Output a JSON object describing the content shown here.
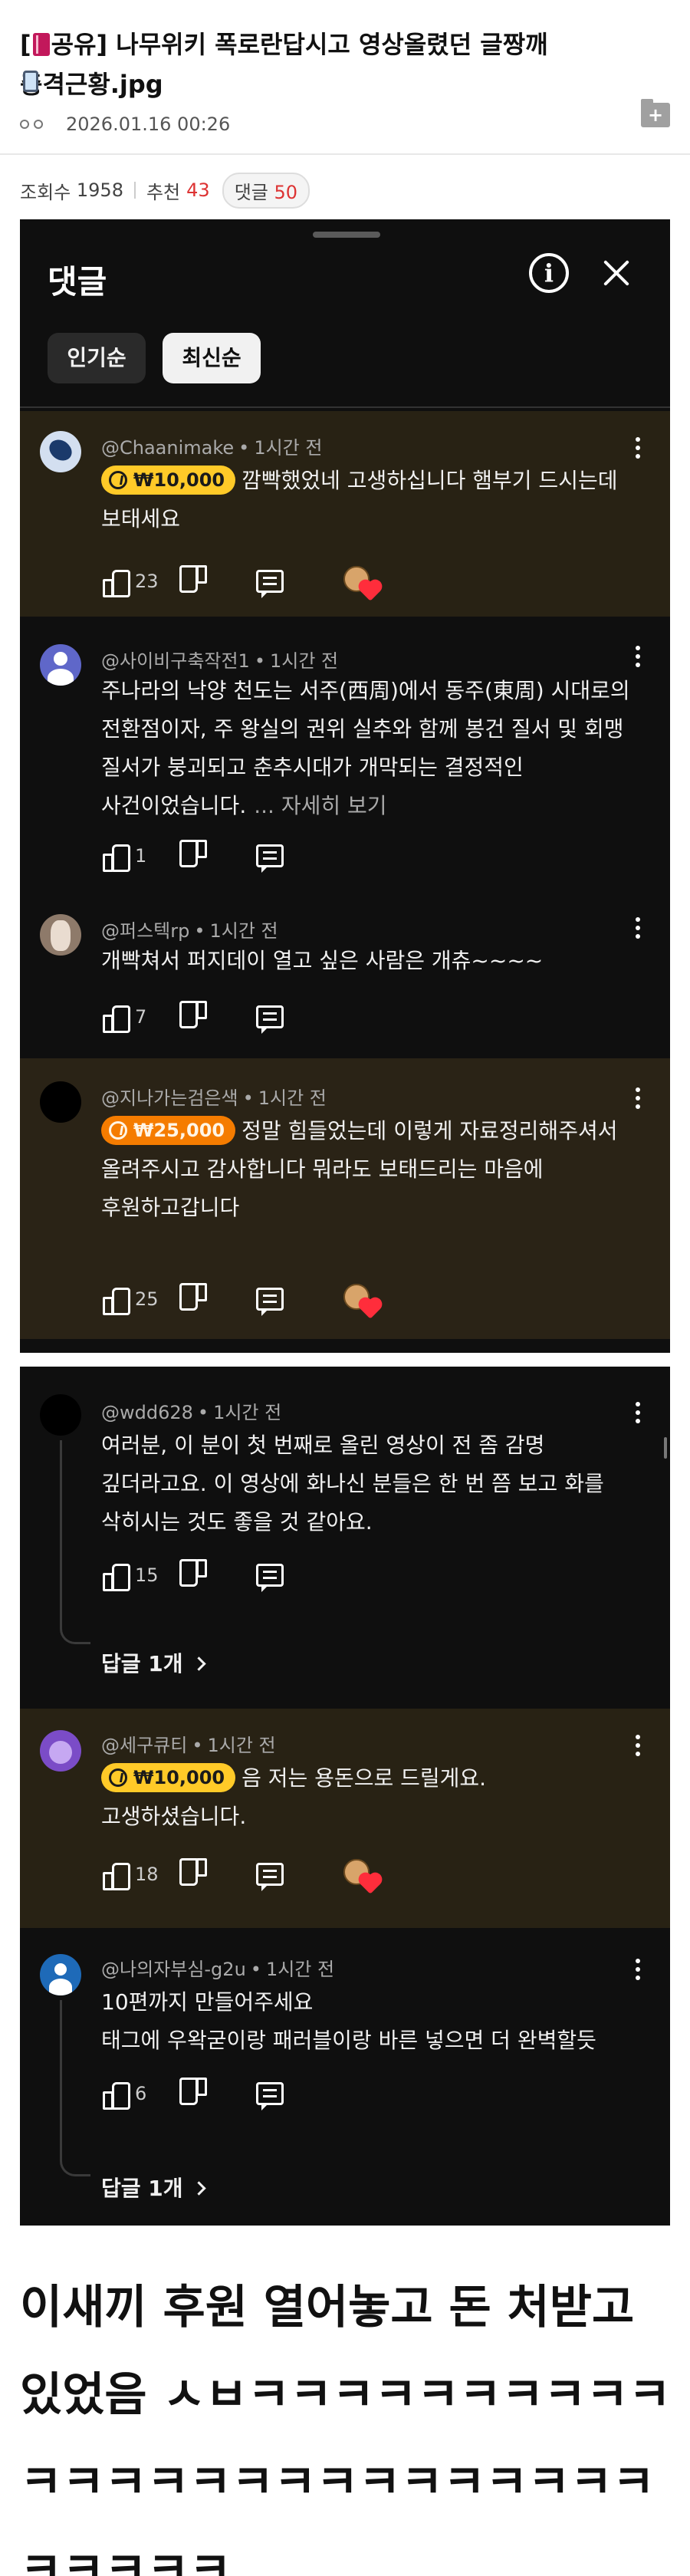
{
  "post": {
    "title_tag": "[",
    "title_category": "공유]",
    "title_text": " 나무위키 폭로란답시고 영상올렸던 글짱깨 충격근황.jpg",
    "date": "2026.01.16 00:26",
    "views_label": "조회수",
    "views": "1958",
    "recommend_label": "추천",
    "recommend": "43",
    "comments_label": "댓글",
    "comments": "50"
  },
  "panel": {
    "title": "댓글",
    "info_icon": "i",
    "chips": [
      "인기순",
      "최신순"
    ],
    "selected_chip": "최신순"
  },
  "comments": [
    {
      "handle": "@Chaanimake",
      "time": "1시간 전",
      "superchat": "₩10,000",
      "superchat_color": "#ffca28",
      "text": "깜빡했었네 고생하십니다 햄부기 드시는데 보태세요",
      "likes": "23",
      "creator_heart": true
    },
    {
      "handle": "@사이비구축작전1",
      "time": "1시간 전",
      "text": "주나라의 낙양 천도는 서주(西周)에서 동주(東周) 시대로의 전환점이자, 주 왕실의 권위 실추와 함께 봉건 질서 및 회맹 질서가 붕괴되고 춘추시대가 개막되는 결정적인 사건이었습니다.",
      "more": "... 자세히 보기",
      "likes": "1"
    },
    {
      "handle": "@퍼스텍rp",
      "time": "1시간 전",
      "text": "개빡쳐서 퍼지데이 열고 싶은 사람은 개츄~~~~",
      "likes": "7"
    },
    {
      "handle": "@지나가는검은색",
      "time": "1시간 전",
      "superchat": "₩25,000",
      "superchat_color": "#f57c00",
      "text": "정말 힘들었는데 이렇게 자료정리해주셔서 올려주시고 감사합니다 뭐라도 보태드리는 마음에 후원하고갑니다",
      "likes": "25",
      "creator_heart": true
    },
    {
      "handle": "@wdd628",
      "time": "1시간 전",
      "text": "여러분, 이 분이 첫 번째로 올린 영상이 전 좀 감명 깊더라고요. 이 영상에 화나신 분들은 한 번 쯤 보고 화를 삭히시는 것도 좋을 것 같아요.",
      "likes": "15",
      "replies": "답글 1개"
    },
    {
      "handle": "@세구큐티",
      "time": "1시간 전",
      "superchat": "₩10,000",
      "superchat_color": "#ffca28",
      "text": "음 저는 용돈으로 드릴게요. 고생하셨습니다.",
      "likes": "18",
      "creator_heart": true
    },
    {
      "handle": "@나의자부심-g2u",
      "time": "1시간 전",
      "text_line1": "10편까지 만들어주세요",
      "text_line2": "태그에 우왁굳이랑 패러블이랑 바른 넣으면 더 완벽할듯",
      "likes": "6",
      "replies": "답글 1개"
    }
  ],
  "caption": "이새끼 후원 열어놓고 돈 처받고 있었음 ㅅㅂㅋㅋㅋㅋㅋㅋㅋㅋㅋㅋㅋㅋㅋㅋㅋㅋㅋㅋㅋㅋㅋㅋㅋㅋㅋㅋㅋㅋㅋㅋ"
}
